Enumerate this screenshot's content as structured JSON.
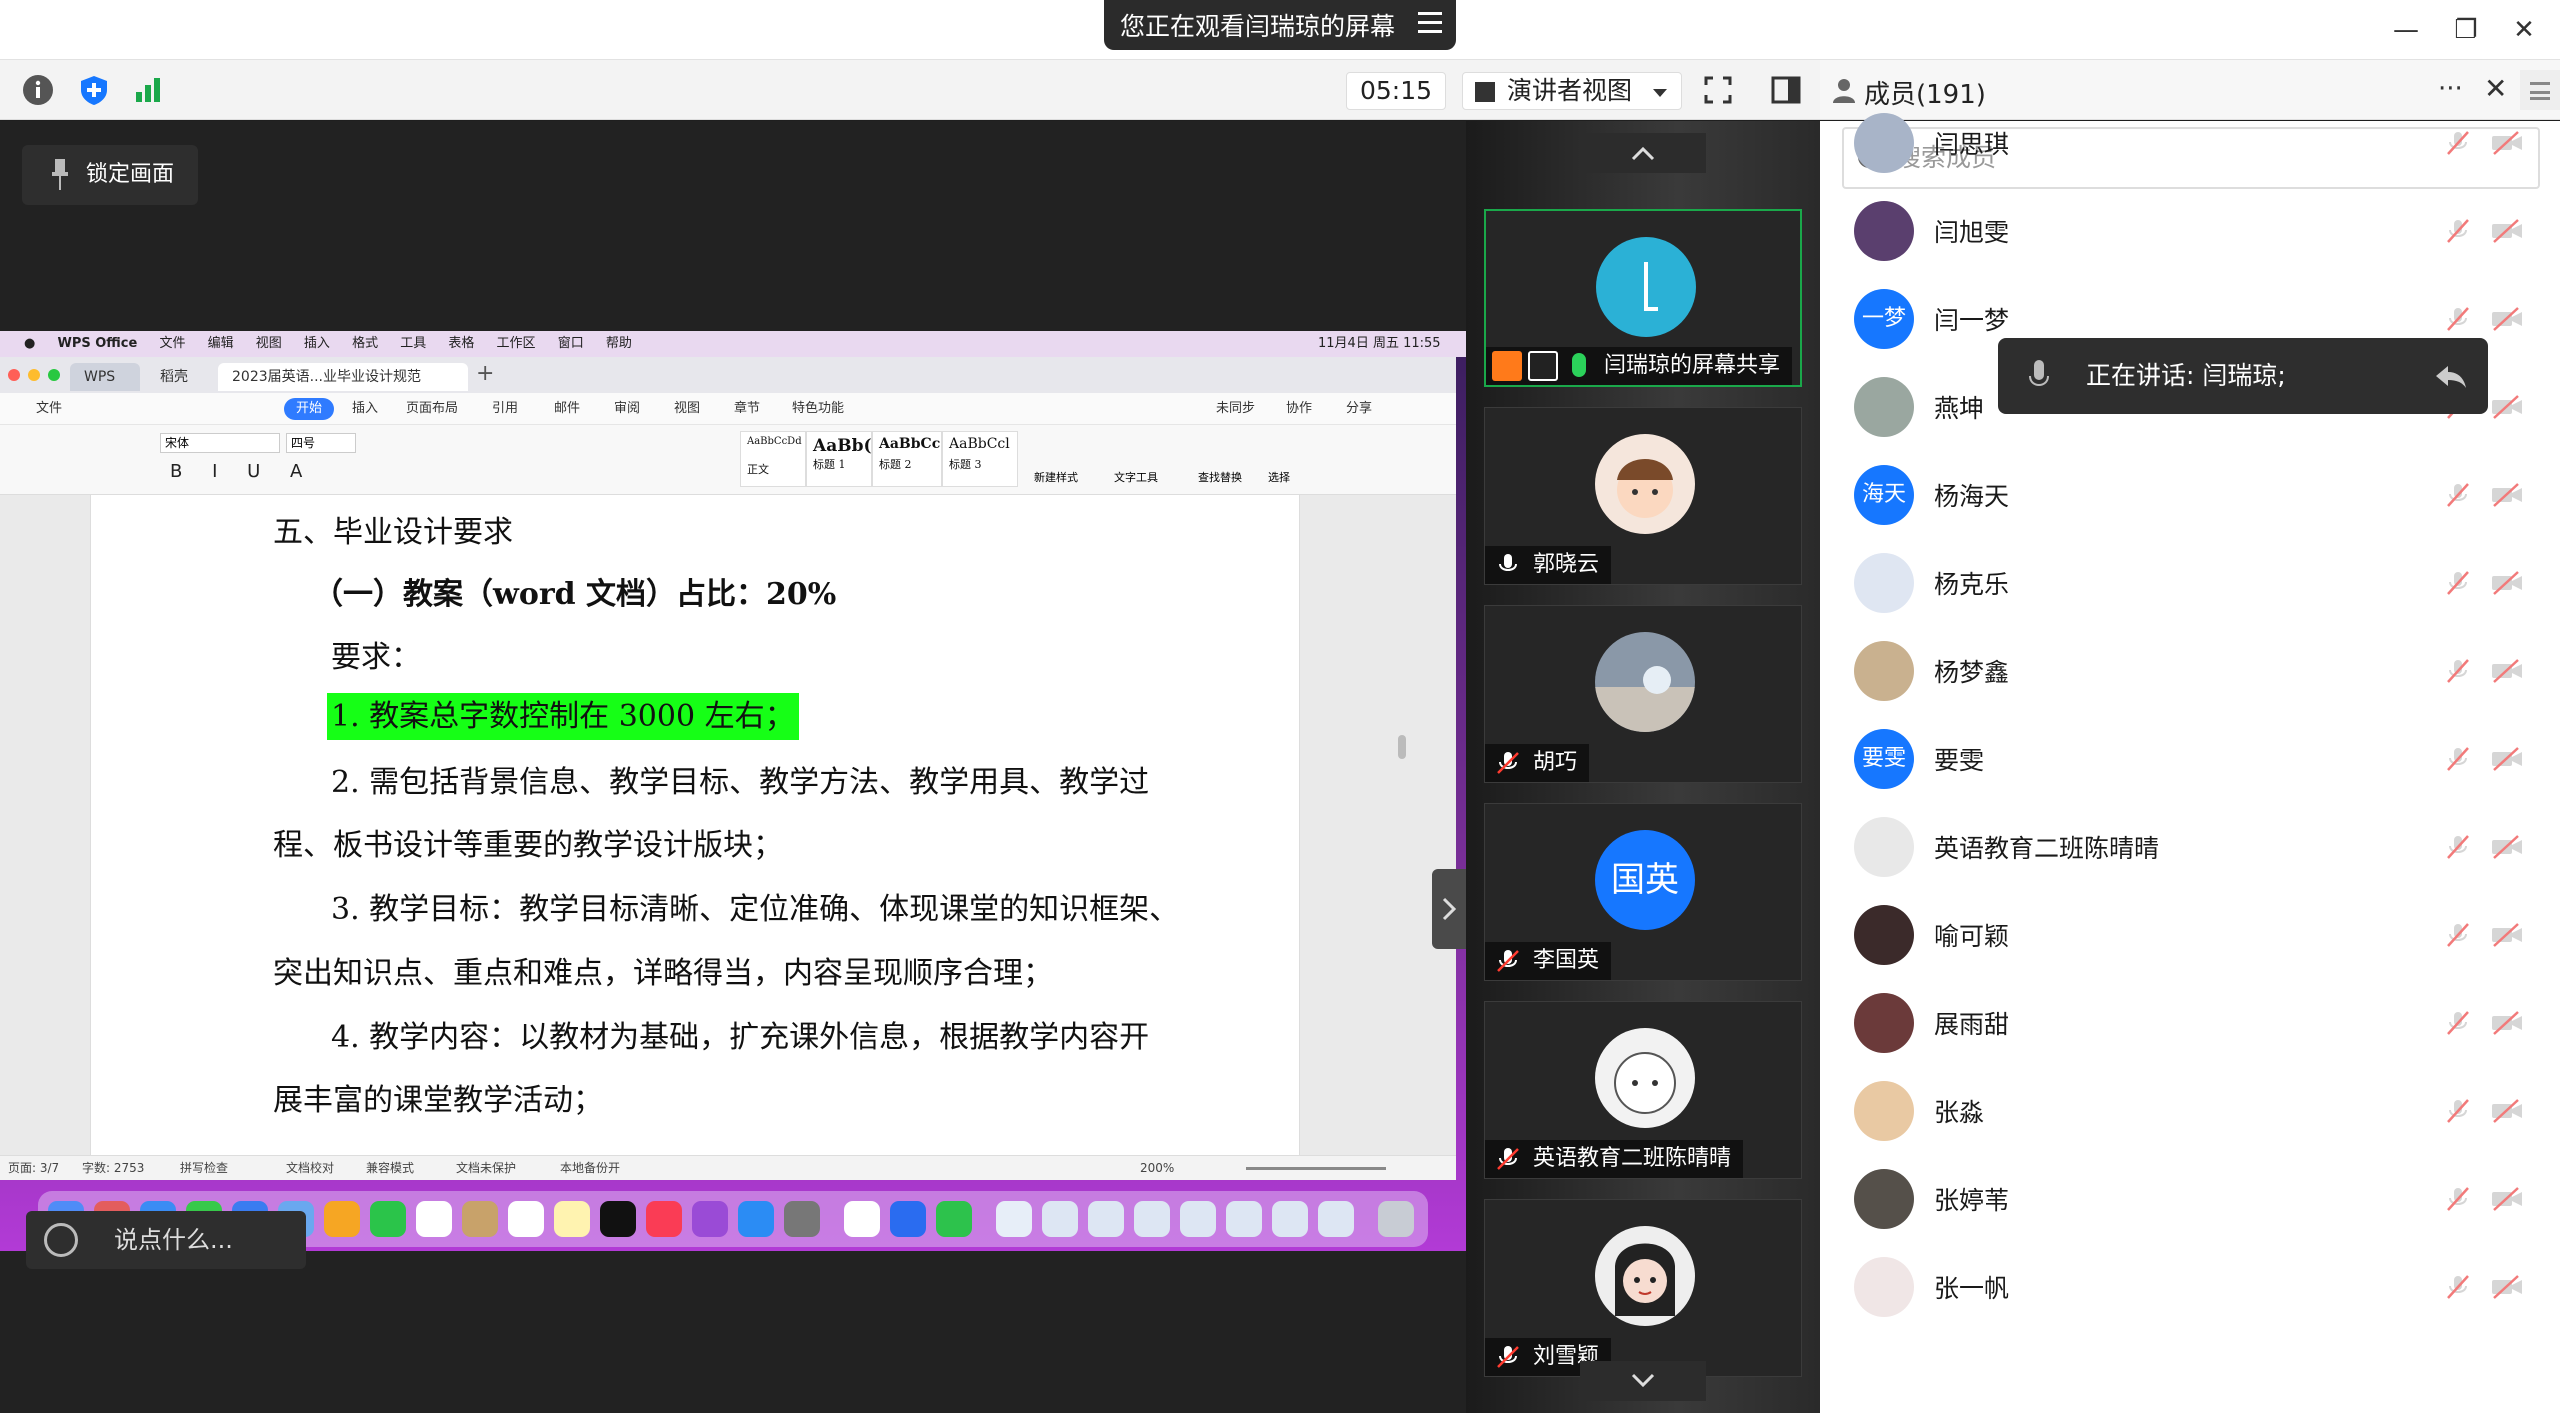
{
  "titlebar": {
    "share_notice": "您正在观看闫瑞琼的屏幕"
  },
  "toolbar": {
    "timer": "05:15",
    "view_mode": "演讲者视图"
  },
  "stage": {
    "lock_label": "锁定画面",
    "chat_placeholder": "说点什么..."
  },
  "mac": {
    "menu": [
      "WPS Office",
      "文件",
      "编辑",
      "视图",
      "插入",
      "格式",
      "工具",
      "表格",
      "工作区",
      "窗口",
      "帮助"
    ],
    "clock": "11月4日 周五 11:55"
  },
  "wps": {
    "tab_home": "WPS",
    "tab_shell": "稻壳",
    "tab_doc": "2023届英语...业毕业设计规范",
    "menu": [
      "文件",
      "开始",
      "插入",
      "页面布局",
      "引用",
      "邮件",
      "审阅",
      "视图",
      "章节",
      "特色功能"
    ],
    "sync": "未同步",
    "collab": "协作",
    "share": "分享",
    "font": "宋体",
    "size": "四号",
    "styles": [
      "AaBbCcDd",
      "AaBb(",
      "AaBbCc",
      "AaBbCcl"
    ],
    "style_names": [
      "正文",
      "标题 1",
      "标题 2",
      "标题 3"
    ],
    "new_style": "新建样式",
    "text_tool": "文字工具",
    "find_replace": "查找替换",
    "select": "选择",
    "status": {
      "page": "页面: 3/7",
      "words": "字数: 2753",
      "spell": "拼写检查",
      "proof": "文档校对",
      "compat": "兼容模式",
      "unprotected": "文档未保护",
      "backup": "本地备份开",
      "zoom": "200%"
    }
  },
  "document": {
    "heading": "五、毕业设计要求",
    "sub": "（一）教案（word 文档）占比：20%",
    "req": "要求：",
    "item1": "1. 教案总字数控制在 3000 左右；",
    "item2a": "2. 需包括背景信息、教学目标、教学方法、教学用具、教学过",
    "item2b": "程、板书设计等重要的教学设计版块；",
    "item3a": "3. 教学目标：教学目标清晰、定位准确、体现课堂的知识框架、",
    "item3b": "突出知识点、重点和难点，详略得当，内容呈现顺序合理；",
    "item4a": "4. 教学内容：以教材为基础，扩充课外信息，根据教学内容开",
    "item4b": "展丰富的课堂教学活动；"
  },
  "video_tiles": [
    {
      "name": "闫瑞琼的屏幕共享"
    },
    {
      "name": "郭晓云"
    },
    {
      "name": "胡巧"
    },
    {
      "name": "李国英",
      "initials": "国英"
    },
    {
      "name": "英语教育二班陈晴晴"
    },
    {
      "name": "刘雪颖"
    }
  ],
  "members_panel": {
    "title": "成员(191)",
    "search_placeholder": "搜索成员",
    "speaking": "正在讲话: 闫瑞琼;",
    "members": [
      {
        "name": "闫思琪",
        "color": "#a8b4c8"
      },
      {
        "name": "闫旭雯",
        "color": "#5a3f6e"
      },
      {
        "name": "闫一梦",
        "initials": "一梦",
        "color": "#1677ff"
      },
      {
        "name": "燕坤",
        "color": "#9aa7a0"
      },
      {
        "name": "杨海天",
        "initials": "海天",
        "color": "#1677ff"
      },
      {
        "name": "杨克乐",
        "color": "#dfe6f2"
      },
      {
        "name": "杨梦鑫",
        "color": "#c9b18f"
      },
      {
        "name": "要雯",
        "initials": "要雯",
        "color": "#1677ff"
      },
      {
        "name": "英语教育二班陈晴晴",
        "color": "#e8e8e8"
      },
      {
        "name": "喻可颖",
        "color": "#3b2a2a"
      },
      {
        "name": "展雨甜",
        "color": "#6b3a3a"
      },
      {
        "name": "张淼",
        "color": "#e9c9a3"
      },
      {
        "name": "张婷苇",
        "color": "#55504a"
      },
      {
        "name": "张一帆",
        "color": "#f0e6e6"
      }
    ]
  },
  "colors": {
    "accent": "#1677ff",
    "active_tile": "#1aa84a",
    "highlight": "#16ff16"
  }
}
